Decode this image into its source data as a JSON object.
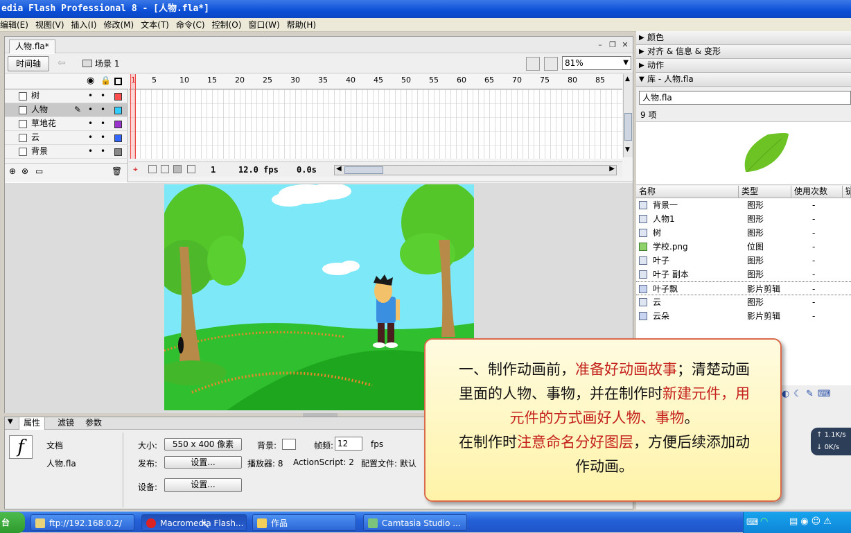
{
  "window": {
    "title": "edia Flash Professional 8 - [人物.fla*]"
  },
  "menu": [
    "编辑(E)",
    "视图(V)",
    "插入(I)",
    "修改(M)",
    "文本(T)",
    "命令(C)",
    "控制(O)",
    "窗口(W)",
    "帮助(H)"
  ],
  "document": {
    "tab": "人物.fla*",
    "timeline_button": "时间轴",
    "scene": "场景 1",
    "zoom": "81%"
  },
  "timeline": {
    "ruler": [
      "1",
      "5",
      "10",
      "15",
      "20",
      "25",
      "30",
      "35",
      "40",
      "45",
      "50",
      "55",
      "60",
      "65",
      "70",
      "75",
      "80",
      "85"
    ],
    "layers": [
      {
        "name": "树",
        "color": "#ff4d4d"
      },
      {
        "name": "人物",
        "color": "#33ccff"
      },
      {
        "name": "草地花",
        "color": "#9933cc"
      },
      {
        "name": "云",
        "color": "#3366ff"
      },
      {
        "name": "背景",
        "color": "#888888"
      }
    ],
    "frame": "1",
    "fps": "12.0 fps",
    "time": "0.0s"
  },
  "properties": {
    "tabs": [
      "属性",
      "滤镜",
      "参数"
    ],
    "type": "文档",
    "filename": "人物.fla",
    "size_label": "大小:",
    "size_value": "550 x 400 像素",
    "bg_label": "背景:",
    "fps_label": "帧频:",
    "fps_value": "12",
    "fps_unit": "fps",
    "publish_label": "发布:",
    "publish_btn": "设置...",
    "player_label": "播放器: 8",
    "as_label": "ActionScript: 2",
    "profile_label": "配置文件: 默认",
    "device_label": "设备:",
    "device_btn": "设置..."
  },
  "panels": {
    "color": "颜色",
    "align": "对齐 & 信息 & 变形",
    "actions": "动作",
    "library": "库 - 人物.fla"
  },
  "library": {
    "selector": "人物.fla",
    "count": "9 项",
    "columns": [
      "名称",
      "类型",
      "使用次数",
      "链"
    ],
    "items": [
      {
        "name": "背景一",
        "type": "图形",
        "uses": "-"
      },
      {
        "name": "人物1",
        "type": "图形",
        "uses": "-"
      },
      {
        "name": "树",
        "type": "图形",
        "uses": "-"
      },
      {
        "name": "学校.png",
        "type": "位图",
        "uses": "-"
      },
      {
        "name": "叶子",
        "type": "图形",
        "uses": "-"
      },
      {
        "name": "叶子 副本",
        "type": "图形",
        "uses": "-"
      },
      {
        "name": "叶子飘",
        "type": "影片剪辑",
        "uses": "-"
      },
      {
        "name": "云",
        "type": "图形",
        "uses": "-"
      },
      {
        "name": "云朵",
        "type": "影片剪辑",
        "uses": "-"
      }
    ]
  },
  "callout": {
    "l1a": "一、制作动画前，",
    "l1b": "准备好动画故事",
    "l1c": "；清楚动画",
    "l2a": "里面的人物、事物，并在制作时",
    "l2b": "新建元件，用",
    "l3": "元件的方式画好人物、事物",
    "l3e": "。",
    "l4a": "在制作时",
    "l4b": "注意命名分好图层",
    "l4c": "，方便后续添加动",
    "l5": "作动画。"
  },
  "netspeed": {
    "up": "1.1K/s",
    "down": "0K/s"
  },
  "taskbar": {
    "start": "台",
    "items": [
      "ftp://192.168.0.2/",
      "Macromedia Flash...",
      "作品",
      "Camtasia Studio ..."
    ]
  }
}
